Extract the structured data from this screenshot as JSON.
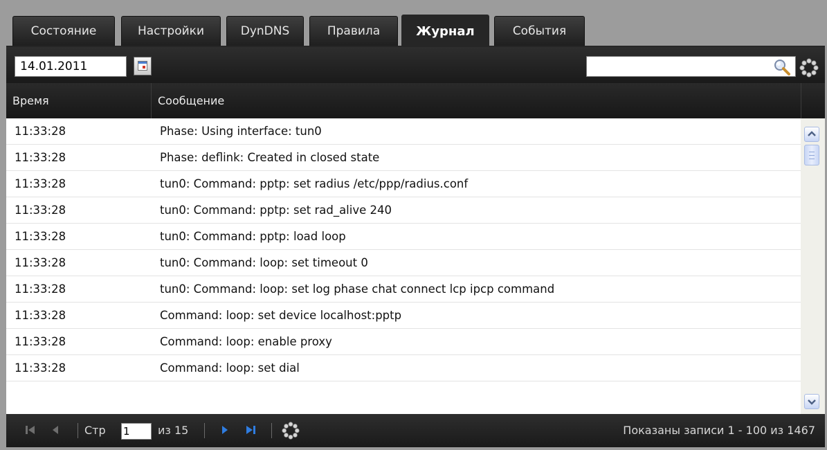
{
  "tabs": [
    {
      "label": "Состояние",
      "active": false
    },
    {
      "label": "Настройки",
      "active": false
    },
    {
      "label": "DynDNS",
      "active": false
    },
    {
      "label": "Правила",
      "active": false
    },
    {
      "label": "Журнал",
      "active": true
    },
    {
      "label": "События",
      "active": false
    }
  ],
  "toolbar": {
    "date_value": "14.01.2011",
    "search_value": ""
  },
  "grid": {
    "columns": [
      "Время",
      "Сообщение"
    ],
    "rows": [
      {
        "time": "11:33:28",
        "message": "Phase: Using interface: tun0"
      },
      {
        "time": "11:33:28",
        "message": "Phase: deflink: Created in closed state"
      },
      {
        "time": "11:33:28",
        "message": "tun0: Command: pptp: set radius /etc/ppp/radius.conf"
      },
      {
        "time": "11:33:28",
        "message": "tun0: Command: pptp: set rad_alive 240"
      },
      {
        "time": "11:33:28",
        "message": "tun0: Command: pptp: load loop"
      },
      {
        "time": "11:33:28",
        "message": "tun0: Command: loop: set timeout 0"
      },
      {
        "time": "11:33:28",
        "message": "tun0: Command: loop: set log phase chat connect lcp ipcp command"
      },
      {
        "time": "11:33:28",
        "message": "Command: loop: set device localhost:pptp"
      },
      {
        "time": "11:33:28",
        "message": "Command: loop: enable proxy"
      },
      {
        "time": "11:33:28",
        "message": "Command: loop: set dial"
      }
    ]
  },
  "pager": {
    "page_label": "Стр",
    "page_value": "1",
    "of_label": "из 15",
    "summary": "Показаны записи 1 - 100 из 1467"
  },
  "colors": {
    "chrome_dark": "#262626",
    "page_bg": "#9c9c9c",
    "nav_arrow_active": "#2f7de1",
    "nav_arrow_disabled": "#6e6e6e"
  }
}
